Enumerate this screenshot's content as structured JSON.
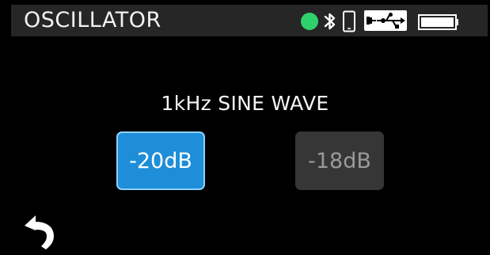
{
  "header": {
    "title": "OSCILLATOR",
    "status_icons": [
      "connection-dot-icon",
      "bluetooth-icon",
      "phone-icon",
      "usb-power-icon",
      "battery-icon"
    ],
    "status_dot_color": "#2fd06e"
  },
  "main": {
    "heading": "1kHz SINE WAVE",
    "levels": [
      {
        "label": "-20dB",
        "selected": true
      },
      {
        "label": "-18dB",
        "selected": false
      }
    ],
    "accent_color": "#1e8ed8"
  },
  "footer": {
    "back_icon": "back-arrow-icon"
  }
}
